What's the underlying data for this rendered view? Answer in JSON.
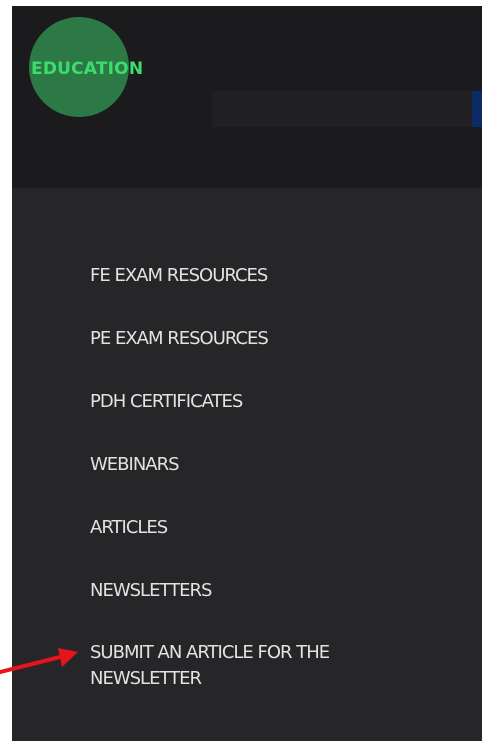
{
  "brand": {
    "logo_text": "EDUCATION"
  },
  "search": {
    "placeholder": ""
  },
  "menu": {
    "items": [
      {
        "label": "FE EXAM RESOURCES"
      },
      {
        "label": "PE EXAM RESOURCES"
      },
      {
        "label": "PDH CERTIFICATES"
      },
      {
        "label": "WEBINARS"
      },
      {
        "label": "ARTICLES"
      },
      {
        "label": "NEWSLETTERS"
      },
      {
        "label": "SUBMIT AN ARTICLE FOR THE NEWSLETTER"
      }
    ]
  },
  "annotation": {
    "arrow_color": "#e8141c",
    "icon": "red-arrow-icon"
  },
  "colors": {
    "logo_green": "#2f8a4e",
    "logo_text_green": "#3ddc6e",
    "panel_bg": "#262628",
    "header_bg": "#1b1b1d",
    "search_accent": "#0b2a66"
  }
}
